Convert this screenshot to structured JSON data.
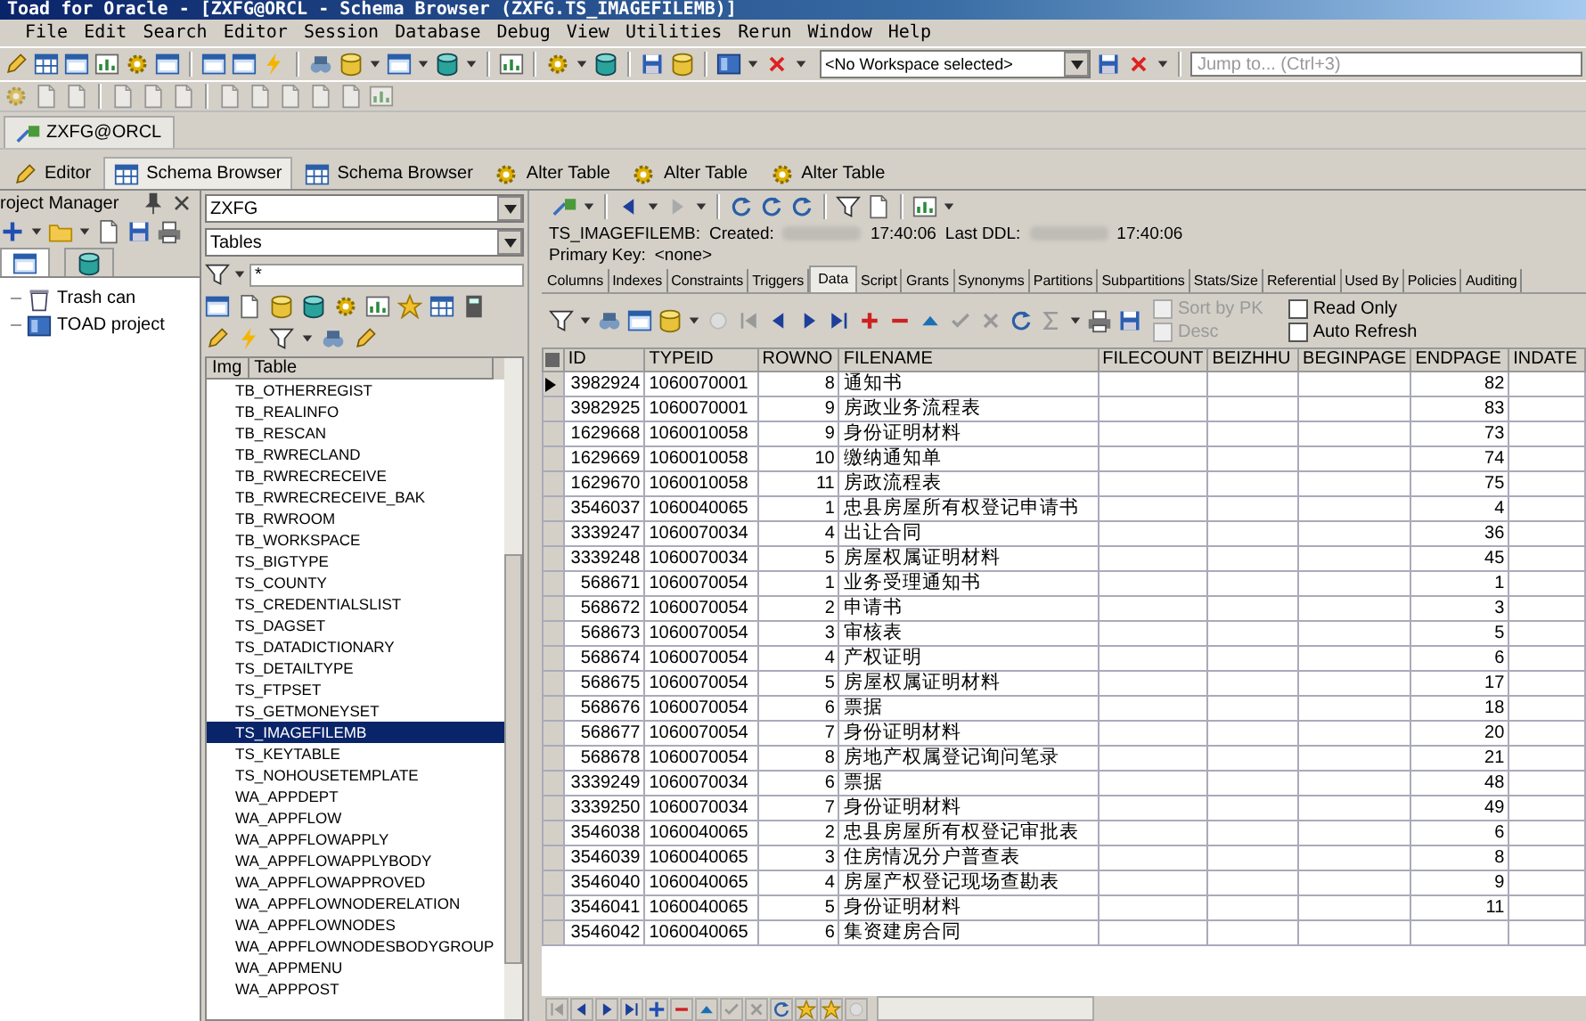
{
  "window": {
    "title": "Toad for Oracle - [ZXFG@ORCL - Schema Browser (ZXFG.TS_IMAGEFILEMB)]"
  },
  "menu": [
    "File",
    "Edit",
    "Search",
    "Editor",
    "Session",
    "Database",
    "Debug",
    "View",
    "Utilities",
    "Rerun",
    "Window",
    "Help"
  ],
  "toolbar": {
    "workspace": "<No Workspace selected>",
    "jump_placeholder": "Jump to... (Ctrl+3)"
  },
  "connection_tabs": [
    {
      "label": "ZXFG@ORCL",
      "selected": true
    }
  ],
  "document_tabs": [
    {
      "label": "Editor",
      "selected": false
    },
    {
      "label": "Schema Browser",
      "selected": true
    },
    {
      "label": "Schema Browser",
      "selected": false
    },
    {
      "label": "Alter Table",
      "selected": false
    },
    {
      "label": "Alter Table",
      "selected": false
    },
    {
      "label": "Alter Table",
      "selected": false
    }
  ],
  "project_manager": {
    "title": "roject Manager",
    "items": [
      {
        "label": "Trash can"
      },
      {
        "label": "TOAD project"
      }
    ]
  },
  "schema_browser": {
    "schema": "ZXFG",
    "object_type": "Tables",
    "filter": "*",
    "columns": [
      "Img",
      "Table"
    ],
    "tables": [
      {
        "name": "TB_OTHERREGIST",
        "selected": false
      },
      {
        "name": "TB_REALINFO",
        "selected": false
      },
      {
        "name": "TB_RESCAN",
        "selected": false
      },
      {
        "name": "TB_RWRECLAND",
        "selected": false
      },
      {
        "name": "TB_RWRECRECEIVE",
        "selected": false
      },
      {
        "name": "TB_RWRECRECEIVE_BAK",
        "selected": false
      },
      {
        "name": "TB_RWROOM",
        "selected": false
      },
      {
        "name": "TB_WORKSPACE",
        "selected": false
      },
      {
        "name": "TS_BIGTYPE",
        "selected": false
      },
      {
        "name": "TS_COUNTY",
        "selected": false
      },
      {
        "name": "TS_CREDENTIALSLIST",
        "selected": false
      },
      {
        "name": "TS_DAGSET",
        "selected": false
      },
      {
        "name": "TS_DATADICTIONARY",
        "selected": false
      },
      {
        "name": "TS_DETAILTYPE",
        "selected": false
      },
      {
        "name": "TS_FTPSET",
        "selected": false
      },
      {
        "name": "TS_GETMONEYSET",
        "selected": false
      },
      {
        "name": "TS_IMAGEFILEMB",
        "selected": true
      },
      {
        "name": "TS_KEYTABLE",
        "selected": false
      },
      {
        "name": "TS_NOHOUSETEMPLATE",
        "selected": false
      },
      {
        "name": "WA_APPDEPT",
        "selected": false
      },
      {
        "name": "WA_APPFLOW",
        "selected": false
      },
      {
        "name": "WA_APPFLOWAPPLY",
        "selected": false
      },
      {
        "name": "WA_APPFLOWAPPLYBODY",
        "selected": false
      },
      {
        "name": "WA_APPFLOWAPPROVED",
        "selected": false
      },
      {
        "name": "WA_APPFLOWNODERELATION",
        "selected": false
      },
      {
        "name": "WA_APPFLOWNODES",
        "selected": false
      },
      {
        "name": "WA_APPFLOWNODESBODYGROUP",
        "selected": false
      },
      {
        "name": "WA_APPMENU",
        "selected": false
      },
      {
        "name": "WA_APPPOST",
        "selected": false
      }
    ]
  },
  "object_panel": {
    "name": "TS_IMAGEFILEMB:",
    "created_label": "Created:",
    "created_time": "17:40:06",
    "ddl_label": "Last DDL:",
    "ddl_time": "17:40:06",
    "primary_key_label": "Primary Key:",
    "primary_key": "<none>",
    "tabs": [
      {
        "label": "Columns",
        "selected": false
      },
      {
        "label": "Indexes",
        "selected": false
      },
      {
        "label": "Constraints",
        "selected": false
      },
      {
        "label": "Triggers",
        "selected": false
      },
      {
        "label": "Data",
        "selected": true
      },
      {
        "label": "Script",
        "selected": false
      },
      {
        "label": "Grants",
        "selected": false
      },
      {
        "label": "Synonyms",
        "selected": false
      },
      {
        "label": "Partitions",
        "selected": false
      },
      {
        "label": "Subpartitions",
        "selected": false
      },
      {
        "label": "Stats/Size",
        "selected": false
      },
      {
        "label": "Referential",
        "selected": false
      },
      {
        "label": "Used By",
        "selected": false
      },
      {
        "label": "Policies",
        "selected": false
      },
      {
        "label": "Auditing",
        "selected": false
      }
    ],
    "options": [
      {
        "label": "Sort by PK",
        "checked": false,
        "disabled": true
      },
      {
        "label": "Desc",
        "checked": false,
        "disabled": true
      },
      {
        "label": "Read Only",
        "checked": false,
        "disabled": false
      },
      {
        "label": "Auto Refresh",
        "checked": false,
        "disabled": false
      }
    ],
    "grid": {
      "columns": [
        "ID",
        "TYPEID",
        "ROWNO",
        "FILENAME",
        "FILECOUNT",
        "BEIZHHU",
        "BEGINPAGE",
        "ENDPAGE",
        "INDATE"
      ],
      "rows": [
        {
          "current": true,
          "id": "3982924",
          "typeid": "1060070001",
          "rowno": "8",
          "filename": "通知书",
          "endpage": "82"
        },
        {
          "current": false,
          "id": "3982925",
          "typeid": "1060070001",
          "rowno": "9",
          "filename": "房政业务流程表",
          "endpage": "83"
        },
        {
          "current": false,
          "id": "1629668",
          "typeid": "1060010058",
          "rowno": "9",
          "filename": "身份证明材料",
          "endpage": "73"
        },
        {
          "current": false,
          "id": "1629669",
          "typeid": "1060010058",
          "rowno": "10",
          "filename": "缴纳通知单",
          "endpage": "74"
        },
        {
          "current": false,
          "id": "1629670",
          "typeid": "1060010058",
          "rowno": "11",
          "filename": "房政流程表",
          "endpage": "75"
        },
        {
          "current": false,
          "id": "3546037",
          "typeid": "1060040065",
          "rowno": "1",
          "filename": "忠县房屋所有权登记申请书",
          "endpage": "4"
        },
        {
          "current": false,
          "id": "3339247",
          "typeid": "1060070034",
          "rowno": "4",
          "filename": "出让合同",
          "endpage": "36"
        },
        {
          "current": false,
          "id": "3339248",
          "typeid": "1060070034",
          "rowno": "5",
          "filename": "房屋权属证明材料",
          "endpage": "45"
        },
        {
          "current": false,
          "id": "568671",
          "typeid": "1060070054",
          "rowno": "1",
          "filename": "业务受理通知书",
          "endpage": "1"
        },
        {
          "current": false,
          "id": "568672",
          "typeid": "1060070054",
          "rowno": "2",
          "filename": "申请书",
          "endpage": "3"
        },
        {
          "current": false,
          "id": "568673",
          "typeid": "1060070054",
          "rowno": "3",
          "filename": "审核表",
          "endpage": "5"
        },
        {
          "current": false,
          "id": "568674",
          "typeid": "1060070054",
          "rowno": "4",
          "filename": "产权证明",
          "endpage": "6"
        },
        {
          "current": false,
          "id": "568675",
          "typeid": "1060070054",
          "rowno": "5",
          "filename": "房屋权属证明材料",
          "endpage": "17"
        },
        {
          "current": false,
          "id": "568676",
          "typeid": "1060070054",
          "rowno": "6",
          "filename": "票据",
          "endpage": "18"
        },
        {
          "current": false,
          "id": "568677",
          "typeid": "1060070054",
          "rowno": "7",
          "filename": "身份证明材料",
          "endpage": "20"
        },
        {
          "current": false,
          "id": "568678",
          "typeid": "1060070054",
          "rowno": "8",
          "filename": "房地产权属登记询问笔录",
          "endpage": "21"
        },
        {
          "current": false,
          "id": "3339249",
          "typeid": "1060070034",
          "rowno": "6",
          "filename": "票据",
          "endpage": "48"
        },
        {
          "current": false,
          "id": "3339250",
          "typeid": "1060070034",
          "rowno": "7",
          "filename": "身份证明材料",
          "endpage": "49"
        },
        {
          "current": false,
          "id": "3546038",
          "typeid": "1060040065",
          "rowno": "2",
          "filename": "忠县房屋所有权登记审批表",
          "endpage": "6"
        },
        {
          "current": false,
          "id": "3546039",
          "typeid": "1060040065",
          "rowno": "3",
          "filename": "住房情况分户普查表",
          "endpage": "8"
        },
        {
          "current": false,
          "id": "3546040",
          "typeid": "1060040065",
          "rowno": "4",
          "filename": "房屋产权登记现场查勘表",
          "endpage": "9"
        },
        {
          "current": false,
          "id": "3546041",
          "typeid": "1060040065",
          "rowno": "5",
          "filename": "身份证明材料",
          "endpage": "11"
        },
        {
          "current": false,
          "id": "3546042",
          "typeid": "1060040065",
          "rowno": "6",
          "filename": "集资建房合同"
        }
      ]
    }
  }
}
